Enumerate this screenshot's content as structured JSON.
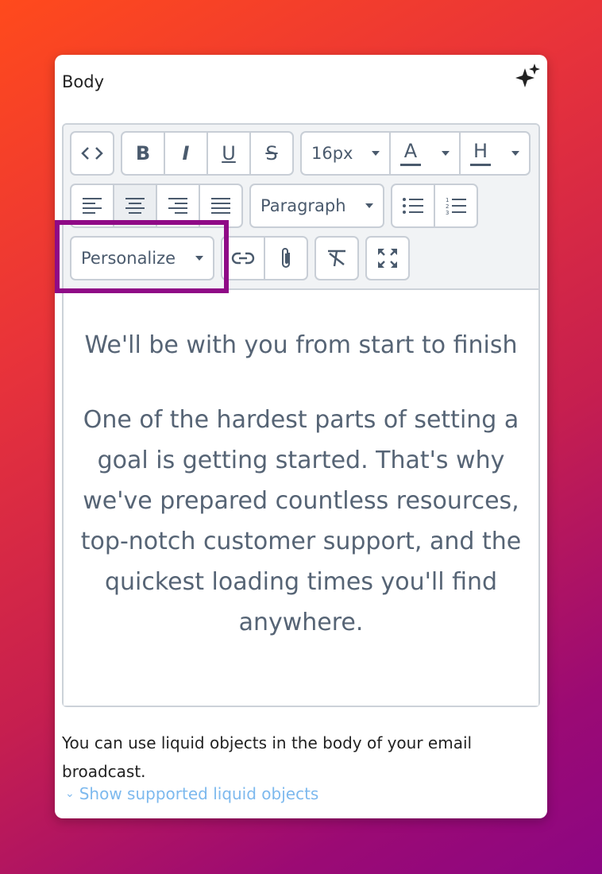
{
  "field": {
    "label": "Body",
    "ai_icon": "sparkle-icon"
  },
  "toolbar": {
    "source_icon": "code-icon",
    "bold": "B",
    "italic": "I",
    "underline": "U",
    "strike": "S",
    "font_size": "16px",
    "text_color_letter": "A",
    "highlight_letter": "H",
    "align_icons": [
      "align-left-icon",
      "align-center-icon",
      "align-right-icon",
      "align-justify-icon"
    ],
    "block_format": "Paragraph",
    "list_icons": [
      "bullet-list-icon",
      "numbered-list-icon"
    ],
    "personalize": "Personalize",
    "link_icon": "link-icon",
    "attach_icon": "paperclip-icon",
    "clear_format_icon": "clear-format-icon",
    "fullscreen_icon": "fullscreen-icon"
  },
  "content": {
    "heading": "We'll be with you from start to finish",
    "paragraph": "One of the hardest parts of setting a goal is getting started. That's why we've prepared countless resources, top-notch customer support, and the quickest loading times you'll find anywhere."
  },
  "help_text": "You can use liquid objects in the body of your email broadcast.",
  "show_link": "Show supported liquid objects",
  "colors": {
    "highlight_border": "#8f0a86",
    "link": "#7db9ee",
    "icon": "#4a5a6d"
  }
}
